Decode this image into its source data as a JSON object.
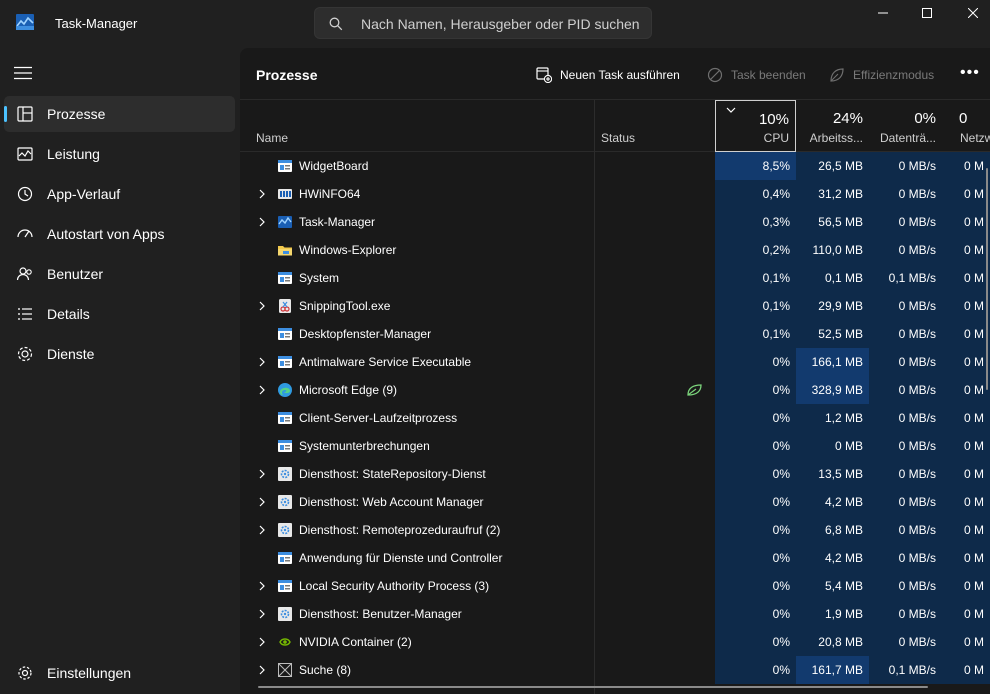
{
  "app": {
    "title": "Task-Manager",
    "search_placeholder": "Nach Namen, Herausgeber oder PID suchen"
  },
  "sidebar": {
    "items": [
      {
        "label": "Prozesse",
        "icon": "processes-icon",
        "active": true
      },
      {
        "label": "Leistung",
        "icon": "performance-icon"
      },
      {
        "label": "App-Verlauf",
        "icon": "history-icon"
      },
      {
        "label": "Autostart von Apps",
        "icon": "startup-icon"
      },
      {
        "label": "Benutzer",
        "icon": "users-icon"
      },
      {
        "label": "Details",
        "icon": "details-icon"
      },
      {
        "label": "Dienste",
        "icon": "services-icon"
      }
    ],
    "settings_label": "Einstellungen"
  },
  "toolbar": {
    "title": "Prozesse",
    "new_task": "Neuen Task ausführen",
    "end_task": "Task beenden",
    "efficiency": "Effizienzmodus"
  },
  "columns": {
    "name": "Name",
    "status": "Status",
    "cpu": {
      "pct": "10%",
      "label": "CPU"
    },
    "memory": {
      "pct": "24%",
      "label": "Arbeitss..."
    },
    "disk": {
      "pct": "0%",
      "label": "Datenträ..."
    },
    "network": {
      "pct": "0",
      "label": "Netzw"
    }
  },
  "colors": {
    "accent": "#4cc2ff",
    "heat_low": "#0e2a4a",
    "heat_mid": "#123a6e",
    "efficiency_leaf": "#7bd37b"
  },
  "processes": [
    {
      "name": "WidgetBoard",
      "expandable": false,
      "icon": "app-window-icon",
      "cpu": "8,5%",
      "mem": "26,5 MB",
      "disk": "0 MB/s",
      "net": "0 M",
      "cpu_heat": 2,
      "mem_heat": 1
    },
    {
      "name": "HWiNFO64",
      "expandable": true,
      "icon": "hwinfo-icon",
      "cpu": "0,4%",
      "mem": "31,2 MB",
      "disk": "0 MB/s",
      "net": "0 M",
      "cpu_heat": 1,
      "mem_heat": 1
    },
    {
      "name": "Task-Manager",
      "expandable": true,
      "icon": "taskmgr-icon",
      "cpu": "0,3%",
      "mem": "56,5 MB",
      "disk": "0 MB/s",
      "net": "0 M",
      "cpu_heat": 1,
      "mem_heat": 1
    },
    {
      "name": "Windows-Explorer",
      "expandable": false,
      "icon": "folder-icon",
      "cpu": "0,2%",
      "mem": "110,0 MB",
      "disk": "0 MB/s",
      "net": "0 M",
      "cpu_heat": 1,
      "mem_heat": 1
    },
    {
      "name": "System",
      "expandable": false,
      "icon": "app-window-icon",
      "cpu": "0,1%",
      "mem": "0,1 MB",
      "disk": "0,1 MB/s",
      "net": "0 M",
      "cpu_heat": 1,
      "mem_heat": 1
    },
    {
      "name": "SnippingTool.exe",
      "expandable": true,
      "icon": "snipping-icon",
      "cpu": "0,1%",
      "mem": "29,9 MB",
      "disk": "0 MB/s",
      "net": "0 M",
      "cpu_heat": 1,
      "mem_heat": 1
    },
    {
      "name": "Desktopfenster-Manager",
      "expandable": false,
      "icon": "app-window-icon",
      "cpu": "0,1%",
      "mem": "52,5 MB",
      "disk": "0 MB/s",
      "net": "0 M",
      "cpu_heat": 1,
      "mem_heat": 1
    },
    {
      "name": "Antimalware Service Executable",
      "expandable": true,
      "icon": "app-window-icon",
      "cpu": "0%",
      "mem": "166,1 MB",
      "disk": "0 MB/s",
      "net": "0 M",
      "cpu_heat": 1,
      "mem_heat": 2
    },
    {
      "name": "Microsoft Edge (9)",
      "expandable": true,
      "icon": "edge-icon",
      "status": "efficiency",
      "cpu": "0%",
      "mem": "328,9 MB",
      "disk": "0 MB/s",
      "net": "0 M",
      "cpu_heat": 1,
      "mem_heat": 2
    },
    {
      "name": "Client-Server-Laufzeitprozess",
      "expandable": false,
      "icon": "app-window-icon",
      "cpu": "0%",
      "mem": "1,2 MB",
      "disk": "0 MB/s",
      "net": "0 M",
      "cpu_heat": 1,
      "mem_heat": 1
    },
    {
      "name": "Systemunterbrechungen",
      "expandable": false,
      "icon": "app-window-icon",
      "cpu": "0%",
      "mem": "0 MB",
      "disk": "0 MB/s",
      "net": "0 M",
      "cpu_heat": 1,
      "mem_heat": 1
    },
    {
      "name": "Diensthost: StateRepository-Dienst",
      "expandable": true,
      "icon": "service-host-icon",
      "cpu": "0%",
      "mem": "13,5 MB",
      "disk": "0 MB/s",
      "net": "0 M",
      "cpu_heat": 1,
      "mem_heat": 1
    },
    {
      "name": "Diensthost: Web Account Manager",
      "expandable": true,
      "icon": "service-host-icon",
      "cpu": "0%",
      "mem": "4,2 MB",
      "disk": "0 MB/s",
      "net": "0 M",
      "cpu_heat": 1,
      "mem_heat": 1
    },
    {
      "name": "Diensthost: Remoteprozeduraufruf (2)",
      "expandable": true,
      "icon": "service-host-icon",
      "cpu": "0%",
      "mem": "6,8 MB",
      "disk": "0 MB/s",
      "net": "0 M",
      "cpu_heat": 1,
      "mem_heat": 1
    },
    {
      "name": "Anwendung für Dienste und Controller",
      "expandable": false,
      "icon": "app-window-icon",
      "cpu": "0%",
      "mem": "4,2 MB",
      "disk": "0 MB/s",
      "net": "0 M",
      "cpu_heat": 1,
      "mem_heat": 1
    },
    {
      "name": "Local Security Authority Process (3)",
      "expandable": true,
      "icon": "app-window-icon",
      "cpu": "0%",
      "mem": "5,4 MB",
      "disk": "0 MB/s",
      "net": "0 M",
      "cpu_heat": 1,
      "mem_heat": 1
    },
    {
      "name": "Diensthost: Benutzer-Manager",
      "expandable": true,
      "icon": "service-host-icon",
      "cpu": "0%",
      "mem": "1,9 MB",
      "disk": "0 MB/s",
      "net": "0 M",
      "cpu_heat": 1,
      "mem_heat": 1
    },
    {
      "name": "NVIDIA Container (2)",
      "expandable": true,
      "icon": "nvidia-icon",
      "cpu": "0%",
      "mem": "20,8 MB",
      "disk": "0 MB/s",
      "net": "0 M",
      "cpu_heat": 1,
      "mem_heat": 1
    },
    {
      "name": "Suche (8)",
      "expandable": true,
      "icon": "search-app-icon",
      "cpu": "0%",
      "mem": "161,7 MB",
      "disk": "0,1 MB/s",
      "net": "0 M",
      "cpu_heat": 1,
      "mem_heat": 2
    }
  ]
}
